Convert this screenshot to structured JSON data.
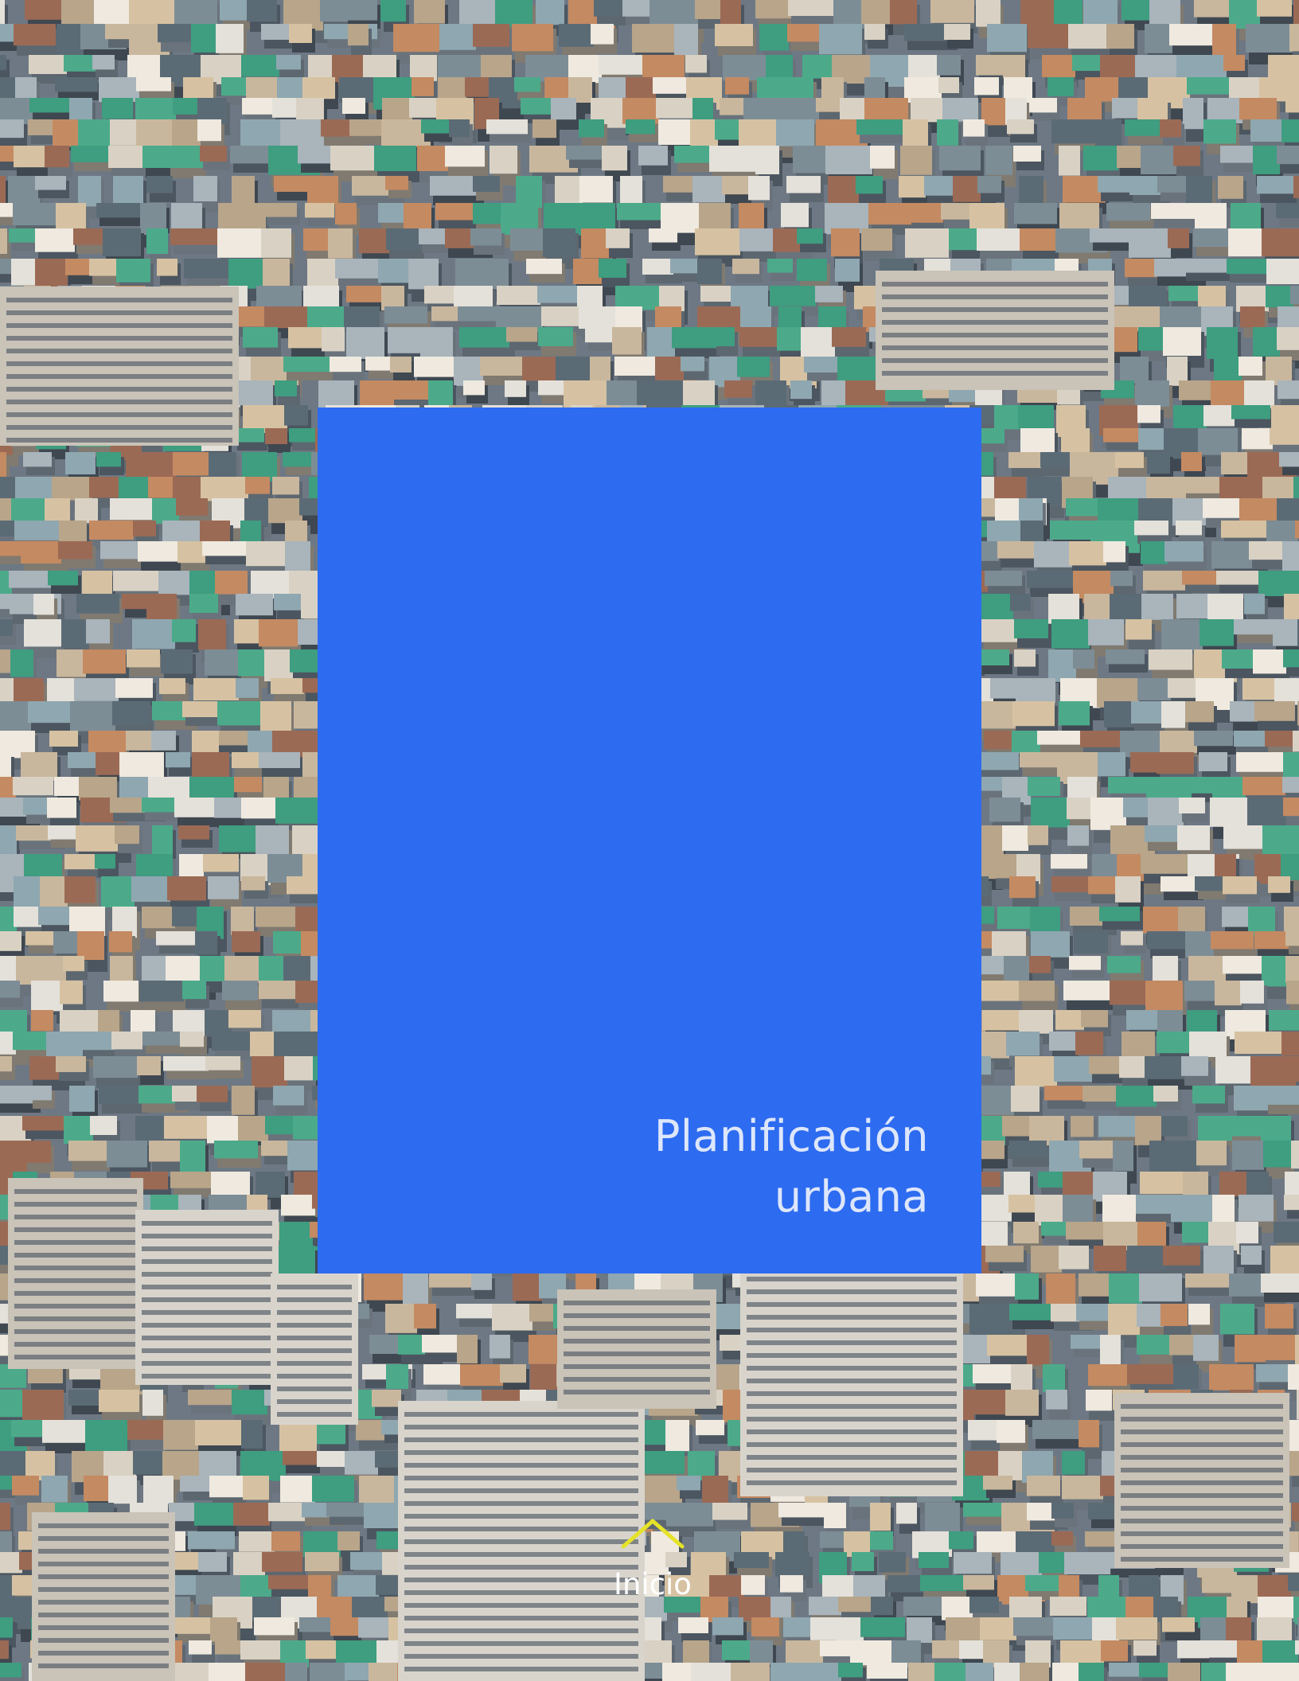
{
  "cover": {
    "title_line1": "Planificación",
    "title_line2": "urbana",
    "panel_color": "#2d6bf0",
    "title_color": "#dde6fb"
  },
  "navigation": {
    "home_label": "Inicio",
    "home_icon": "chevron-up-icon",
    "icon_color": "#e5e22a"
  },
  "background": {
    "kind": "aerial photograph of a dense city"
  }
}
